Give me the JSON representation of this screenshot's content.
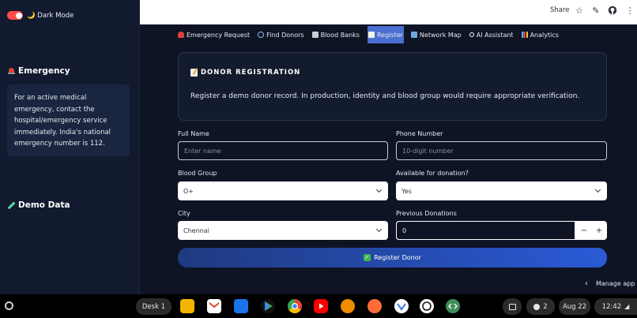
{
  "sidebar": {
    "dark_mode_label": "🌙 Dark Mode",
    "emergency_heading": "Emergency",
    "emergency_text": "For an active medical emergency, contact the hospital/emergency service immediately. India's national emergency number is 112.",
    "demo_heading": "Demo Data"
  },
  "header": {
    "share_label": "Share"
  },
  "tabs": [
    {
      "label": "Emergency Request",
      "icon": "siren-icon",
      "color": "#e0413a"
    },
    {
      "label": "Find Donors",
      "icon": "search-icon",
      "color": "#8fb4ff"
    },
    {
      "label": "Blood Banks",
      "icon": "hospital-icon",
      "color": "#c9ccd4"
    },
    {
      "label": "Register",
      "icon": "memo-icon",
      "color": "#f3f1e6"
    },
    {
      "label": "Network Map",
      "icon": "map-icon",
      "color": "#6fa8dc"
    },
    {
      "label": "AI Assistant",
      "icon": "sparkle-icon",
      "color": "#ffffff"
    },
    {
      "label": "Analytics",
      "icon": "bar-chart-icon",
      "color": "#6fa8dc"
    }
  ],
  "active_tab": "Register",
  "registration": {
    "title": "DONOR REGISTRATION",
    "description": "Register a demo donor record. In production, identity and blood group would require appropriate verification."
  },
  "form": {
    "full_name_label": "Full Name",
    "full_name_placeholder": "Enter name",
    "phone_label": "Phone Number",
    "phone_placeholder": "10-digit number",
    "blood_group_label": "Blood Group",
    "blood_group_value": "O+",
    "available_label": "Available for donation?",
    "available_value": "Yes",
    "city_label": "City",
    "city_value": "Chennai",
    "prev_donations_label": "Previous Donations",
    "prev_donations_value": "0",
    "minus_label": "−",
    "plus_label": "+",
    "submit_label": "Register Donor"
  },
  "manage_app_label": "Manage app",
  "taskbar": {
    "desk_label": "Desk 1",
    "notifications_count": "2",
    "date": "Aug 22",
    "time": "12:42",
    "apps": [
      {
        "name": "meet-icon",
        "color": "#f5b400"
      },
      {
        "name": "gmail-icon",
        "color": "#ffffff"
      },
      {
        "name": "files-icon",
        "color": "#1a73e8"
      },
      {
        "name": "play-store-icon",
        "color": "#ffffff"
      },
      {
        "name": "chrome-icon",
        "color": "#34a853"
      },
      {
        "name": "youtube-icon",
        "color": "#ff0000"
      },
      {
        "name": "vlc-icon",
        "color": "#f08a00"
      },
      {
        "name": "app-orange-icon",
        "color": "#ff6d3b"
      },
      {
        "name": "app-blue-icon",
        "color": "#4a7de2"
      },
      {
        "name": "chatgpt-icon",
        "color": "#ffffff"
      },
      {
        "name": "dev-icon",
        "color": "#3f8f5a"
      }
    ]
  }
}
